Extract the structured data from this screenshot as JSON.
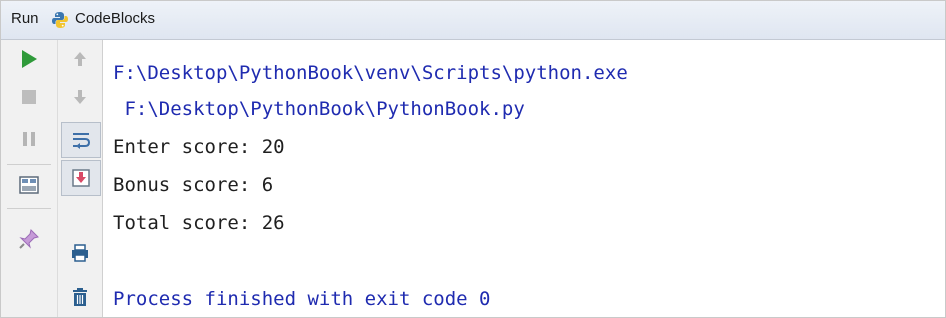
{
  "run_window": {
    "title_label": "Run",
    "config_name": "CodeBlocks"
  },
  "colors": {
    "system_text": "#1f2bb0",
    "output_text": "#1f1f1f",
    "run_green": "#2f9a3a"
  },
  "toolbar_icons": [
    "rerun-icon",
    "stop-icon",
    "pause-icon",
    "layout-icon",
    "pin-icon",
    "up-arrow-icon",
    "down-arrow-icon",
    "soft-wrap-icon",
    "scroll-to-end-icon",
    "print-icon",
    "trash-icon"
  ],
  "console": {
    "line1": "F:\\Desktop\\PythonBook\\venv\\Scripts\\python.exe",
    "line2": " F:\\Desktop\\PythonBook\\PythonBook.py",
    "line3": "Enter score: 20",
    "line4": "Bonus score: 6",
    "line5": "Total score: 26",
    "line6": "",
    "line7": "Process finished with exit code 0"
  }
}
